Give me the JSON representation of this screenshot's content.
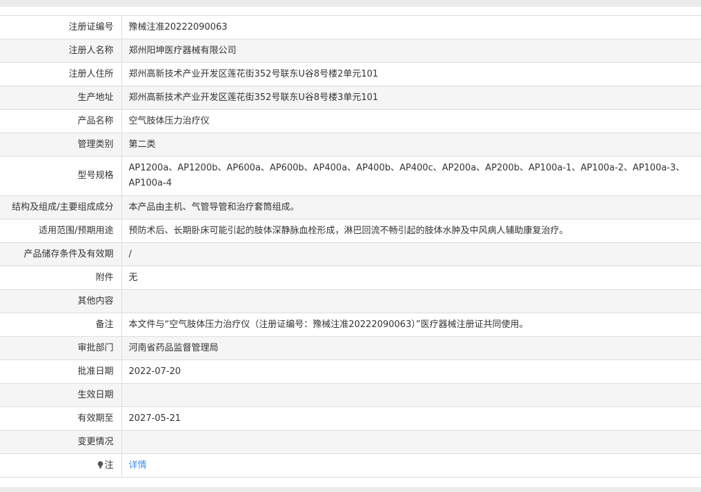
{
  "rows": [
    {
      "label": "注册证编号",
      "value": "豫械注准20222090063"
    },
    {
      "label": "注册人名称",
      "value": "郑州阳坤医疗器械有限公司"
    },
    {
      "label": "注册人住所",
      "value": "郑州高新技术产业开发区莲花街352号联东U谷8号楼2单元101"
    },
    {
      "label": "生产地址",
      "value": "郑州高新技术产业开发区莲花街352号联东U谷8号楼3单元101"
    },
    {
      "label": "产品名称",
      "value": "空气肢体压力治疗仪"
    },
    {
      "label": "管理类别",
      "value": "第二类"
    },
    {
      "label": "型号规格",
      "value": "AP1200a、AP1200b、AP600a、AP600b、AP400a、AP400b、AP400c、AP200a、AP200b、AP100a-1、AP100a-2、AP100a-3、AP100a-4"
    },
    {
      "label": "结构及组成/主要组成成分",
      "value": "本产品由主机、气管导管和治疗套筒组成。"
    },
    {
      "label": "适用范围/预期用途",
      "value": "预防术后、长期卧床可能引起的肢体深静脉血栓形成，淋巴回流不畅引起的肢体水肿及中风病人辅助康复治疗。"
    },
    {
      "label": "产品储存条件及有效期",
      "value": "/"
    },
    {
      "label": "附件",
      "value": "无"
    },
    {
      "label": "其他内容",
      "value": ""
    },
    {
      "label": "备注",
      "value": "本文件与“空气肢体压力治疗仪（注册证编号：豫械注准20222090063）”医疗器械注册证共同使用。"
    },
    {
      "label": "审批部门",
      "value": "河南省药品监督管理局"
    },
    {
      "label": "批准日期",
      "value": "2022-07-20"
    },
    {
      "label": "生效日期",
      "value": ""
    },
    {
      "label": "有效期至",
      "value": "2027-05-21"
    },
    {
      "label": "变更情况",
      "value": ""
    }
  ],
  "note": {
    "label": "注",
    "icon": "lightbulb-icon",
    "link_text": "详情",
    "link_color": "#3a8ee6"
  }
}
